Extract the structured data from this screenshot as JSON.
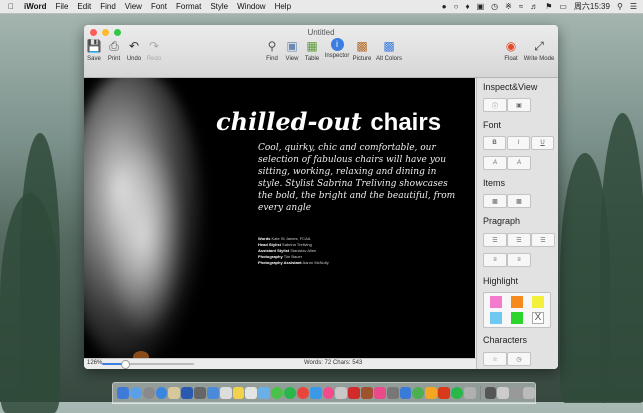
{
  "menubar": {
    "app_name": "iWord",
    "menus": [
      "File",
      "Edit",
      "Find",
      "View",
      "Font",
      "Format",
      "Style",
      "Window",
      "Help"
    ],
    "clock": "周六15:39"
  },
  "window": {
    "title": "Untitled",
    "toolbar": {
      "save": "Save",
      "print": "Print",
      "undo": "Undo",
      "redo": "Redo",
      "find": "Find",
      "view": "View",
      "table": "Table",
      "inspector": "Inspector",
      "picture": "Picture",
      "alt_colors": "Alt Colors",
      "float": "Float",
      "write_mode": "Write Mode"
    }
  },
  "document": {
    "headline_italic": "chilled-out",
    "headline_bold": "chairs",
    "intro": "Cool, quirky, chic and comfortable, our selection of fabulous chairs will have you sitting, working, relaxing and dining in style. Stylist Sabrina Treliving showcases the bold, the bright and the beautiful, from every angle",
    "credits": [
      {
        "role": "Words",
        "name": "Kate St James, FCAA"
      },
      {
        "role": "Head Stylist",
        "name": "Sabrina Treliving"
      },
      {
        "role": "Assistant Stylist",
        "name": "Stanislav Allen"
      },
      {
        "role": "Photography",
        "name": "Tim Bauer"
      },
      {
        "role": "Photography Assistant",
        "name": "Aaron McNulty"
      }
    ]
  },
  "sidebar": {
    "inspect_view": "Inspect&View",
    "font": "Font",
    "font_buttons": [
      "B",
      "I",
      "U"
    ],
    "font_buttons2": [
      "A",
      "A"
    ],
    "items": "Items",
    "pragraph": "Pragraph",
    "highlight": "Highlight",
    "highlight_colors": [
      "#f27bd0",
      "#f58b1f",
      "#f2f03b",
      "#6fc8f1",
      "#2bd52b"
    ],
    "highlight_clear": "X",
    "characters": "Characters"
  },
  "status": {
    "zoom": "126%",
    "zoom_fraction": 0.25,
    "counts": "Words: 72  Chars: 543"
  },
  "colors": {
    "close": "#fc5f57",
    "minimize": "#fdbc2e",
    "zoom": "#33c748",
    "accent": "#3b7de0"
  }
}
